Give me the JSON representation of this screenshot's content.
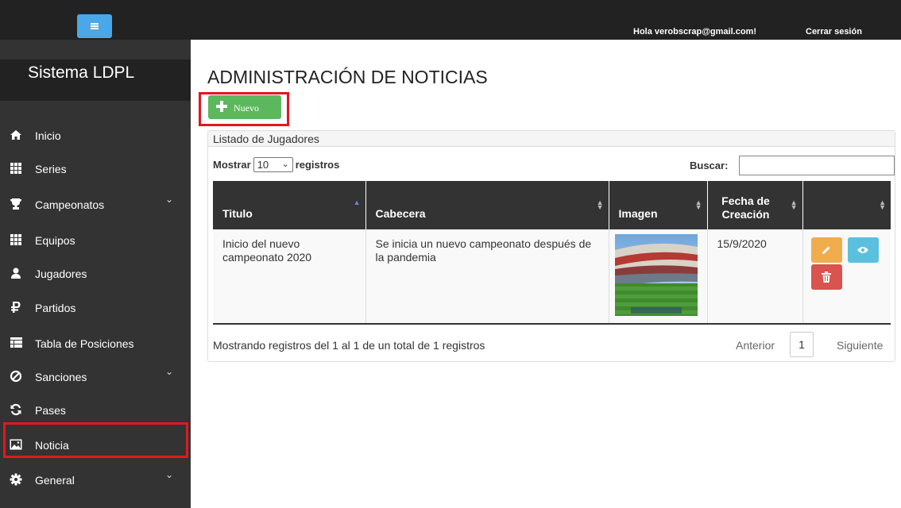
{
  "topbar": {
    "greeting": "Hola verobscrap@gmail.com!",
    "logout_label": "Cerrar sesión"
  },
  "sidebar": {
    "brand": "Sistema LDPL",
    "items": [
      {
        "label": "Inicio",
        "icon": "home-icon"
      },
      {
        "label": "Series",
        "icon": "grid-icon"
      },
      {
        "label": "Campeonatos",
        "icon": "trophy-icon",
        "has_submenu": true
      },
      {
        "label": "Equipos",
        "icon": "grid-icon"
      },
      {
        "label": "Jugadores",
        "icon": "user-icon"
      },
      {
        "label": "Partidos",
        "icon": "ruble-icon"
      },
      {
        "label": "Tabla de Posiciones",
        "icon": "table-icon"
      },
      {
        "label": "Sanciones",
        "icon": "ban-icon",
        "has_submenu": true
      },
      {
        "label": "Pases",
        "icon": "refresh-icon"
      },
      {
        "label": "Noticia",
        "icon": "image-icon",
        "active": true
      },
      {
        "label": "General",
        "icon": "gear-icon",
        "has_submenu": true
      }
    ]
  },
  "main": {
    "title": "ADMINISTRACIÓN DE NOTICIAS",
    "new_button_label": "Nuevo",
    "panel_title": "Listado de Jugadores",
    "length": {
      "prefix": "Mostrar",
      "value": "10",
      "suffix": "registros"
    },
    "search_label": "Buscar:",
    "search_value": "",
    "table": {
      "columns": [
        {
          "label": "Titulo",
          "sort": "asc"
        },
        {
          "label": "Cabecera",
          "sort": "both"
        },
        {
          "label": "Imagen",
          "sort": "both"
        },
        {
          "label": "Fecha de Creación",
          "sort": "both"
        },
        {
          "label": "",
          "sort": "both"
        }
      ],
      "rows": [
        {
          "titulo": "Inicio del nuevo campeonato 2020",
          "cabecera": "Se inicia un nuevo campeonato después de la pandemia",
          "imagen": "stadium-photo",
          "fecha": "15/9/2020"
        }
      ]
    },
    "info": "Mostrando registros del 1 al 1 de un total de 1 registros",
    "pagination": {
      "prev": "Anterior",
      "page": "1",
      "next": "Siguiente"
    }
  },
  "colors": {
    "topbar": "#222222",
    "sidebar": "#333333",
    "toggle": "#4aa8e8",
    "success": "#5cb85c",
    "warning": "#f0ad4e",
    "info": "#5bc0de",
    "danger": "#d9534f",
    "highlight": "#e5161d"
  }
}
